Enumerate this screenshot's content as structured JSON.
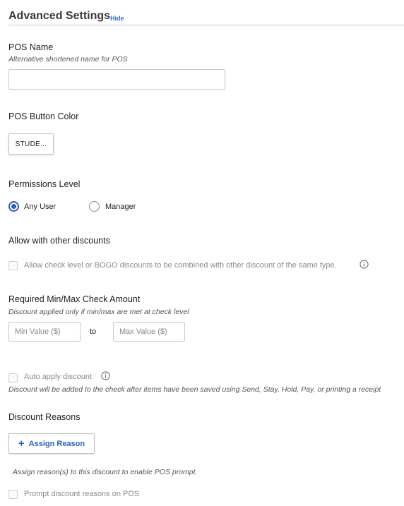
{
  "header": {
    "title": "Advanced Settings",
    "hide_label": "Hide"
  },
  "pos_name": {
    "label": "POS Name",
    "help": "Alternative shortened name for POS",
    "value": "",
    "placeholder": ""
  },
  "pos_button_color": {
    "label": "POS Button Color",
    "button_text": "STUDE..."
  },
  "permissions": {
    "label": "Permissions Level",
    "options": [
      {
        "label": "Any User",
        "selected": true
      },
      {
        "label": "Manager",
        "selected": false
      }
    ]
  },
  "allow_other": {
    "label": "Allow with other discounts",
    "checkbox_label": "Allow check level or BOGO discounts to be combined with other discount of the same type.",
    "checked": false
  },
  "check_amount": {
    "label": "Required Min/Max Check Amount",
    "help": "Discount applied only if min/max are met at check level",
    "min_placeholder": "Min Value ($)",
    "max_placeholder": "Max Value ($)",
    "to_label": "to"
  },
  "auto_apply": {
    "checkbox_label": "Auto apply discount",
    "checked": false,
    "help": "Discount will be added to the check after items have been saved using Send, Stay, Hold, Pay, or printing a receipt"
  },
  "discount_reasons": {
    "label": "Discount Reasons",
    "assign_label": "Assign Reason",
    "assign_help": "Assign reason(s) to this discount to enable POS prompt.",
    "prompt_label": "Prompt discount reasons on POS",
    "prompt_checked": false
  },
  "colors": {
    "accent": "#2a5fc0",
    "link": "#2a6ecf",
    "divider": "#c9c9c9"
  },
  "icons": {
    "info": "info-icon",
    "plus": "plus-icon"
  }
}
